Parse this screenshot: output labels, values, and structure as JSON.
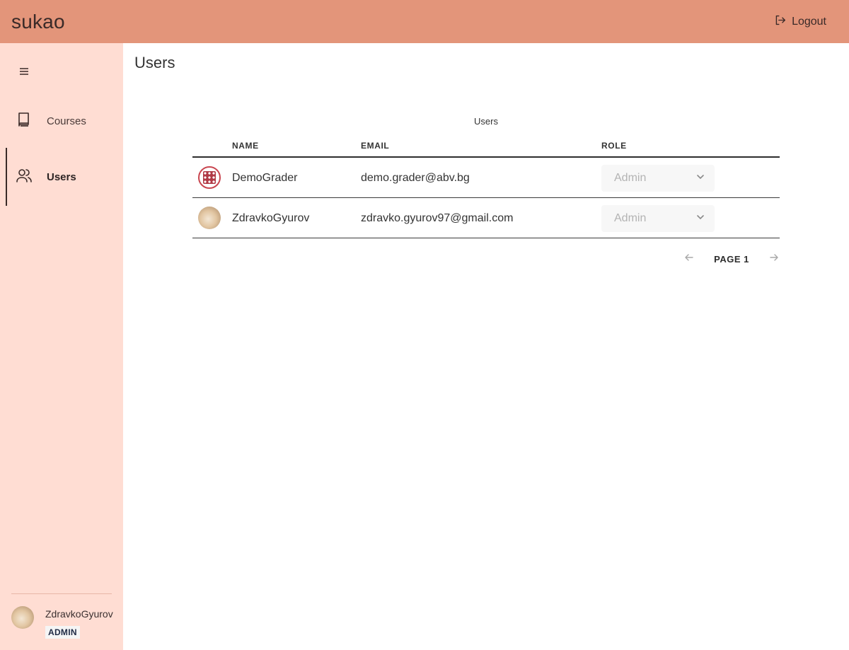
{
  "app": {
    "brand": "sukao"
  },
  "topbar": {
    "logout_label": "Logout"
  },
  "sidebar": {
    "items": [
      {
        "label": "Courses",
        "icon": "book-icon",
        "active": false
      },
      {
        "label": "Users",
        "icon": "users-icon",
        "active": true
      }
    ],
    "current_user": {
      "name": "ZdravkoGyurov",
      "role": "ADMIN"
    }
  },
  "page": {
    "title": "Users"
  },
  "table": {
    "caption": "Users",
    "columns": [
      "NAME",
      "EMAIL",
      "ROLE"
    ],
    "rows": [
      {
        "name": "DemoGrader",
        "email": "demo.grader@abv.bg",
        "role": "Admin",
        "avatar": "grader-avatar"
      },
      {
        "name": "ZdravkoGyurov",
        "email": "zdravko.gyurov97@gmail.com",
        "role": "Admin",
        "avatar": "photo-avatar"
      }
    ]
  },
  "pagination": {
    "label": "PAGE 1"
  },
  "colors": {
    "topbar": "#e3957a",
    "sidebar": "#ffddd3",
    "badge_bg": "#f5f5f5",
    "badge_text": "#1f2a44",
    "select_bg": "#f7f7f7",
    "select_text": "#b3b3b3"
  }
}
